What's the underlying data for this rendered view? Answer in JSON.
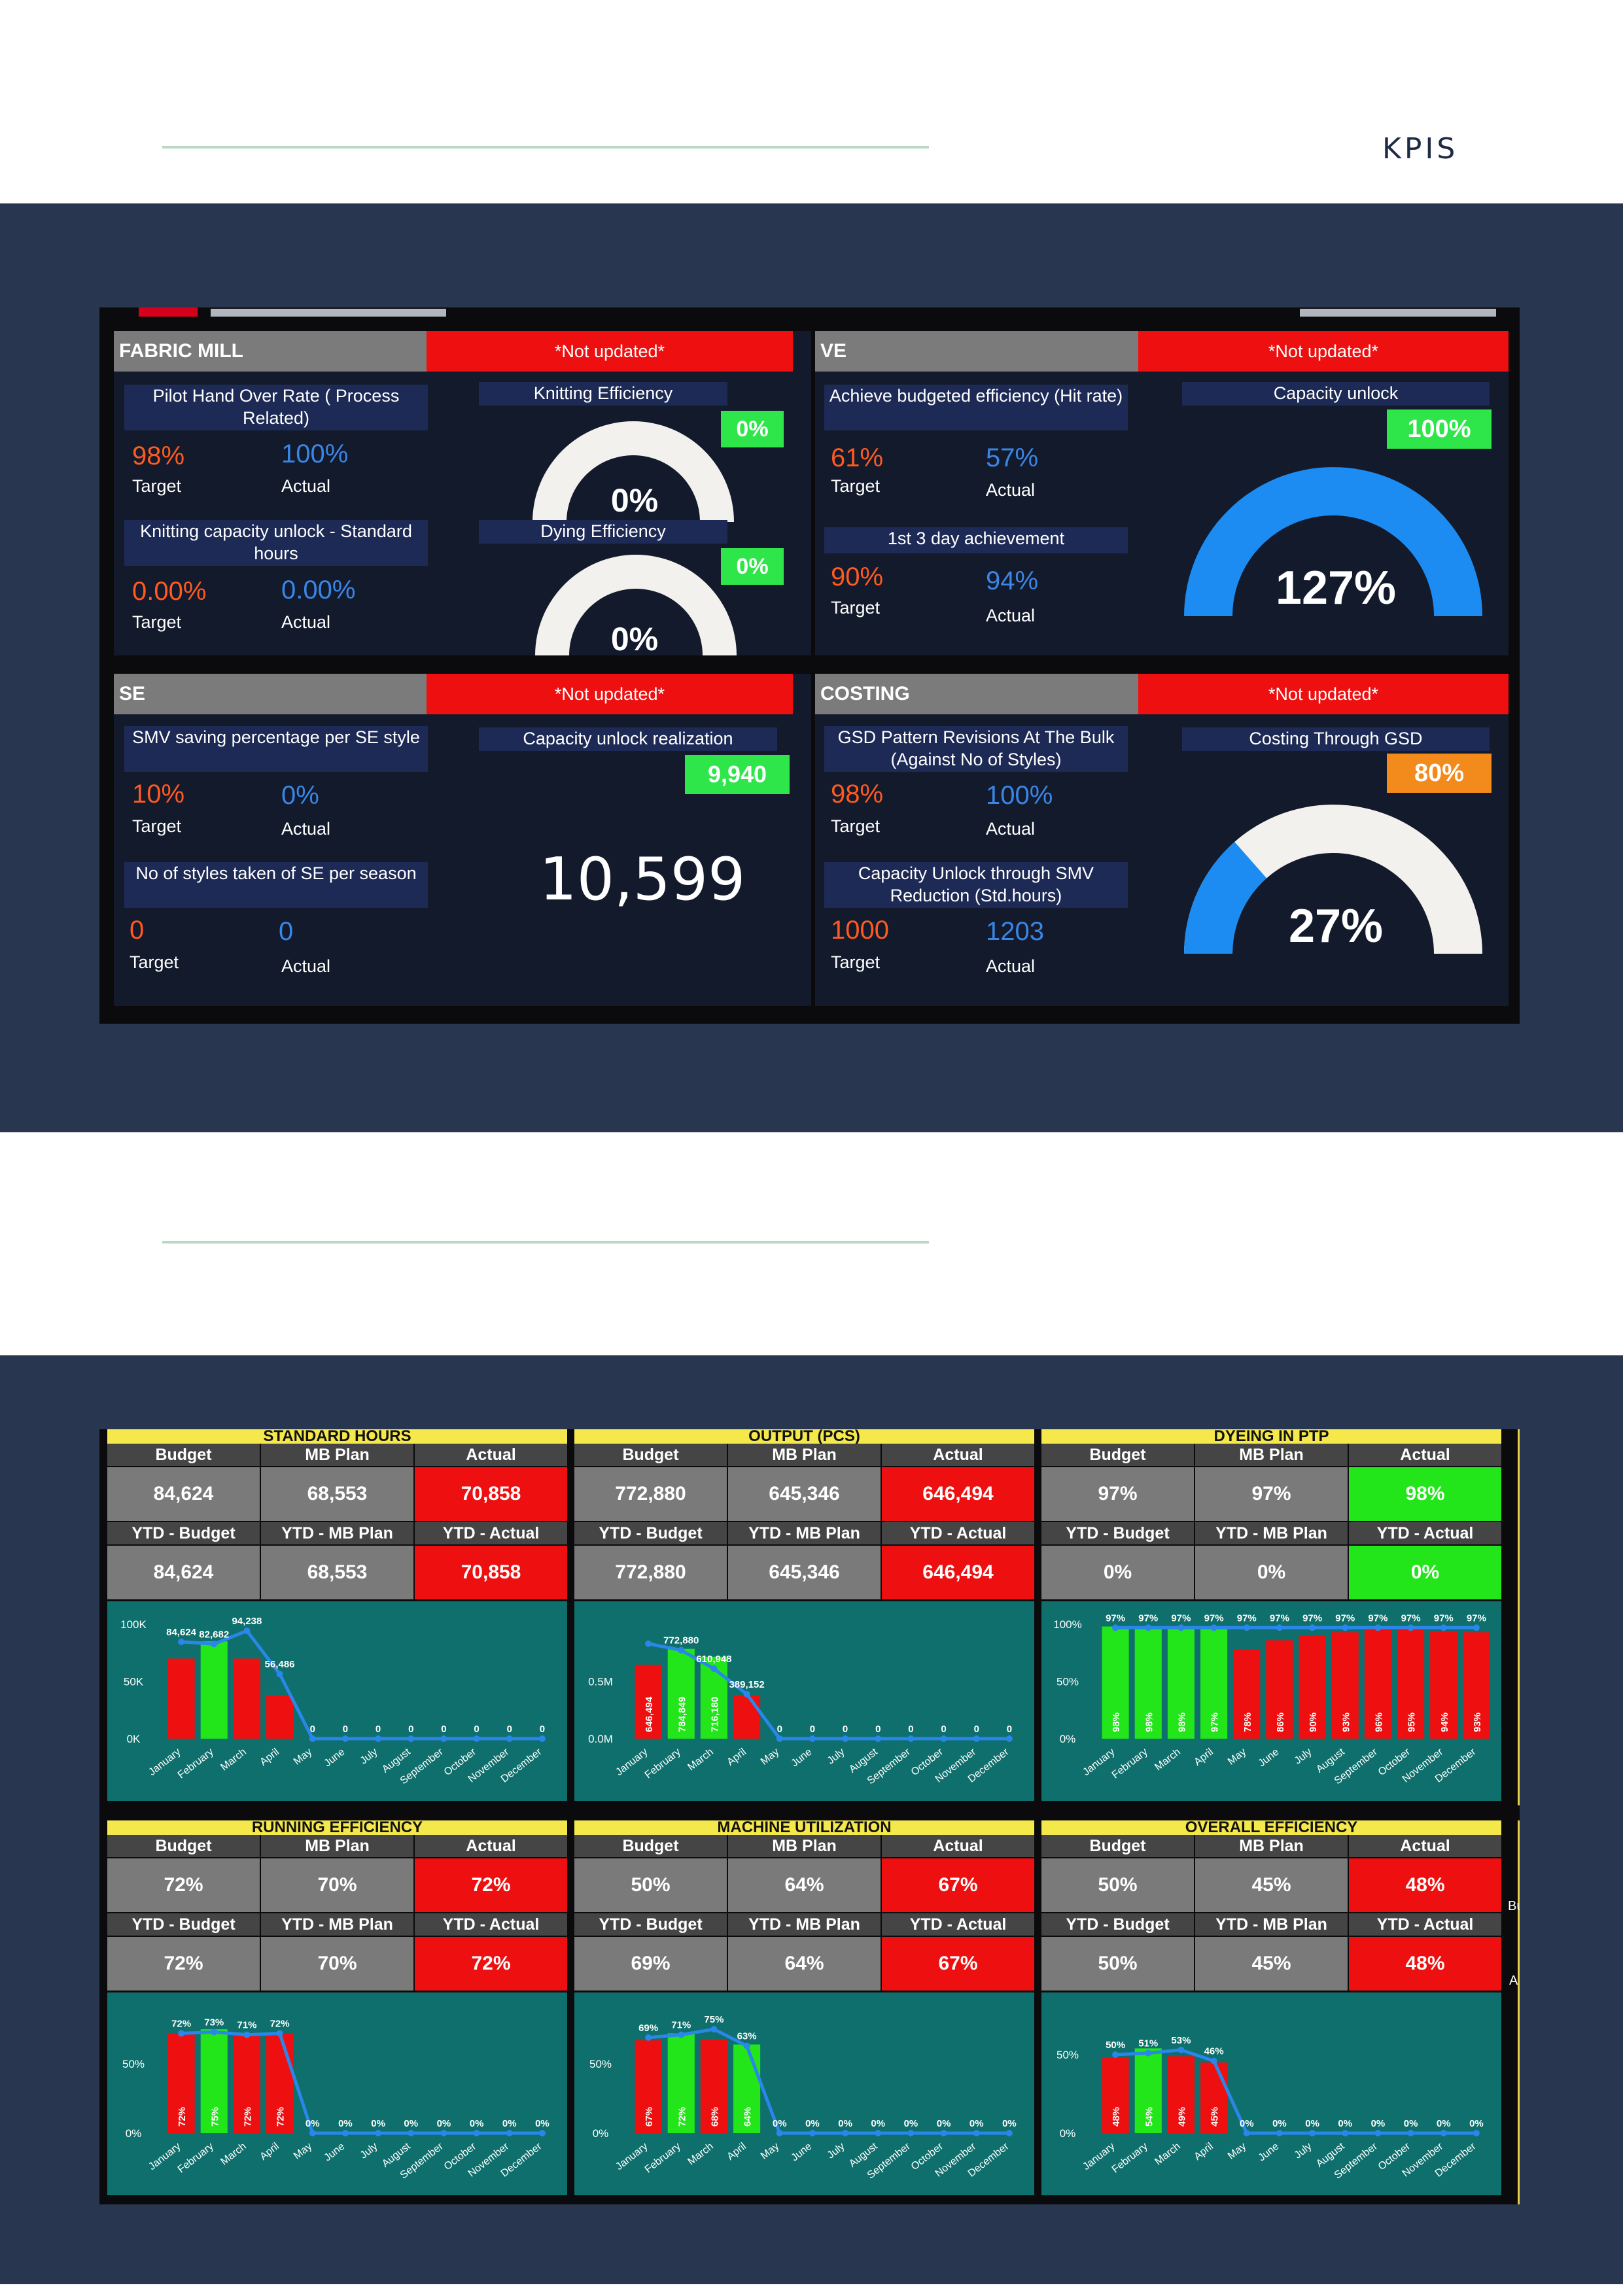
{
  "header": {
    "title": "KPIS"
  },
  "dashboard1": {
    "fabric_mill": {
      "title": "FABRIC MILL",
      "status": "*Not updated*",
      "kpi1": {
        "label": "Pilot Hand Over Rate ( Process Related)",
        "target": "98%",
        "actual": "100%"
      },
      "kpi2": {
        "label": "Knitting capacity unlock - Standard hours",
        "target": "0.00%",
        "actual": "0.00%"
      },
      "gauge1": {
        "title": "Knitting Efficiency",
        "badge": "0%",
        "value": "0%",
        "fraction": 0
      },
      "gauge2": {
        "title": "Dying Efficiency",
        "badge": "0%",
        "value": "0%",
        "fraction": 0
      }
    },
    "ve": {
      "title": "VE",
      "status": "*Not updated*",
      "kpi1": {
        "label": "Achieve budgeted efficiency (Hit rate)",
        "target": "61%",
        "actual": "57%"
      },
      "kpi2": {
        "label": "1st 3 day achievement",
        "target": "90%",
        "actual": "94%"
      },
      "gauge": {
        "title": "Capacity unlock",
        "badge": "100%",
        "value": "127%",
        "fraction": 1
      }
    },
    "se": {
      "title": "SE",
      "status": "*Not updated*",
      "kpi1": {
        "label": "SMV saving percentage per SE style",
        "target": "10%",
        "actual": "0%"
      },
      "kpi2": {
        "label": "No of styles taken of SE per season",
        "target": "0",
        "actual": "0"
      },
      "card": {
        "title": "Capacity unlock realization",
        "badge": "9,940",
        "value": "10,599"
      }
    },
    "costing": {
      "title": "COSTING",
      "status": "*Not updated*",
      "kpi1": {
        "label": "GSD Pattern Revisions At The Bulk (Against No of Styles)",
        "target": "98%",
        "actual": "100%"
      },
      "kpi2": {
        "label": "Capacity Unlock through SMV Reduction (Std.hours)",
        "target": "1000",
        "actual": "1203"
      },
      "gauge": {
        "title": "Costing Through GSD",
        "badge": "80%",
        "value": "27%",
        "fraction": 0.27
      }
    },
    "target_label": "Target",
    "actual_label": "Actual"
  },
  "dashboard2": {
    "headers": {
      "budget": "Budget",
      "mb_plan": "MB Plan",
      "actual": "Actual",
      "ytd_budget": "YTD - Budget",
      "ytd_mb_plan": "YTD - MB Plan",
      "ytd_actual": "YTD - Actual"
    },
    "months": [
      "January",
      "February",
      "March",
      "April",
      "May",
      "June",
      "July",
      "August",
      "September",
      "October",
      "November",
      "December"
    ],
    "side_labels": [
      "Bu",
      "A"
    ],
    "panels": [
      {
        "title": "STANDARD HOURS",
        "budget": "84,624",
        "mb_plan": "68,553",
        "actual": "70,858",
        "ytd_budget": "84,624",
        "ytd_mb_plan": "68,553",
        "ytd_actual": "70,858",
        "actual_color": "red"
      },
      {
        "title": "OUTPUT (PCS)",
        "budget": "772,880",
        "mb_plan": "645,346",
        "actual": "646,494",
        "ytd_budget": "772,880",
        "ytd_mb_plan": "645,346",
        "ytd_actual": "646,494",
        "actual_color": "red"
      },
      {
        "title": "DYEING IN PTP",
        "budget": "97%",
        "mb_plan": "97%",
        "actual": "98%",
        "ytd_budget": "0%",
        "ytd_mb_plan": "0%",
        "ytd_actual": "0%",
        "actual_color": "green"
      },
      {
        "title": "RUNNING EFFICIENCY",
        "budget": "72%",
        "mb_plan": "70%",
        "actual": "72%",
        "ytd_budget": "72%",
        "ytd_mb_plan": "70%",
        "ytd_actual": "72%",
        "actual_color": "red"
      },
      {
        "title": "MACHINE UTILIZATION",
        "budget": "50%",
        "mb_plan": "64%",
        "actual": "67%",
        "ytd_budget": "69%",
        "ytd_mb_plan": "64%",
        "ytd_actual": "67%",
        "actual_color": "red"
      },
      {
        "title": "OVERALL EFFICIENCY",
        "budget": "50%",
        "mb_plan": "45%",
        "actual": "48%",
        "ytd_budget": "50%",
        "ytd_mb_plan": "45%",
        "ytd_actual": "48%",
        "actual_color": "red"
      }
    ]
  },
  "chart_data": [
    {
      "type": "bar",
      "title": "STANDARD HOURS",
      "ytick_labels": [
        "0K",
        "50K",
        "100K"
      ],
      "ylim": [
        0,
        100000
      ],
      "categories": [
        "January",
        "February",
        "March",
        "April",
        "May",
        "June",
        "July",
        "August",
        "September",
        "October",
        "November",
        "December"
      ],
      "series": [
        {
          "kind": "bar",
          "values": [
            70000,
            85000,
            70000,
            38000,
            null,
            null,
            null,
            null,
            null,
            null,
            null,
            null
          ],
          "colors": [
            "red",
            "green",
            "red",
            "red"
          ]
        },
        {
          "kind": "line",
          "values": [
            84624,
            82682,
            94238,
            56486,
            0,
            0,
            0,
            0,
            0,
            0,
            0,
            0
          ]
        }
      ],
      "data_labels": [
        {
          "month": "January",
          "text": "84,624",
          "value": 84624
        },
        {
          "month": "February",
          "text": "82,682",
          "value": 82682
        },
        {
          "month": "March",
          "text": "94,238",
          "value": 94238
        },
        {
          "month": "April",
          "text": "56,486",
          "value": 56486
        },
        {
          "month": "May",
          "text": "0",
          "value": 0
        },
        {
          "month": "June",
          "text": "0",
          "value": 0
        },
        {
          "month": "July",
          "text": "0",
          "value": 0
        },
        {
          "month": "August",
          "text": "0",
          "value": 0
        },
        {
          "month": "September",
          "text": "0",
          "value": 0
        },
        {
          "month": "October",
          "text": "0",
          "value": 0
        },
        {
          "month": "November",
          "text": "0",
          "value": 0
        },
        {
          "month": "December",
          "text": "0",
          "value": 0
        }
      ]
    },
    {
      "type": "bar",
      "title": "OUTPUT (PCS)",
      "ytick_labels": [
        "0.0M",
        "0.5M"
      ],
      "ylim": [
        0,
        1000000
      ],
      "categories": [
        "January",
        "February",
        "March",
        "April",
        "May",
        "June",
        "July",
        "August",
        "September",
        "October",
        "November",
        "December"
      ],
      "series": [
        {
          "kind": "bar",
          "values": [
            646494,
            784849,
            716180,
            380000,
            null,
            null,
            null,
            null,
            null,
            null,
            null,
            null
          ],
          "colors": [
            "red",
            "green",
            "green",
            "red"
          ],
          "inner_labels": [
            "646,494",
            "784,849",
            "716,180",
            ""
          ]
        },
        {
          "kind": "line",
          "values": [
            830000,
            772880,
            610948,
            389152,
            0,
            0,
            0,
            0,
            0,
            0,
            0,
            0
          ]
        }
      ],
      "data_labels": [
        {
          "month": "February",
          "text": "772,880",
          "value": 772880
        },
        {
          "month": "March",
          "text": "610,948",
          "value": 610948
        },
        {
          "month": "April",
          "text": "389,152",
          "value": 389152
        },
        {
          "month": "May",
          "text": "0",
          "value": 0
        },
        {
          "month": "June",
          "text": "0",
          "value": 0
        },
        {
          "month": "July",
          "text": "0",
          "value": 0
        },
        {
          "month": "August",
          "text": "0",
          "value": 0
        },
        {
          "month": "September",
          "text": "0",
          "value": 0
        },
        {
          "month": "October",
          "text": "0",
          "value": 0
        },
        {
          "month": "November",
          "text": "0",
          "value": 0
        },
        {
          "month": "December",
          "text": "0",
          "value": 0
        }
      ]
    },
    {
      "type": "bar",
      "title": "DYEING IN PTP",
      "ytick_labels": [
        "0%",
        "50%",
        "100%"
      ],
      "ylim": [
        0,
        100
      ],
      "categories": [
        "January",
        "February",
        "March",
        "April",
        "May",
        "June",
        "July",
        "August",
        "September",
        "October",
        "November",
        "December"
      ],
      "series": [
        {
          "kind": "bar",
          "values": [
            98,
            98,
            98,
            97,
            78,
            86,
            90,
            93,
            96,
            95,
            94,
            93
          ],
          "colors": [
            "green",
            "green",
            "green",
            "green",
            "red",
            "red",
            "red",
            "red",
            "red",
            "red",
            "red",
            "red"
          ],
          "inner_labels": [
            "98%",
            "98%",
            "98%",
            "97%",
            "78%",
            "86%",
            "90%",
            "93%",
            "96%",
            "95%",
            "94%",
            "93%"
          ]
        },
        {
          "kind": "line",
          "values": [
            97,
            97,
            97,
            97,
            97,
            97,
            97,
            97,
            97,
            97,
            97,
            97
          ]
        }
      ],
      "data_labels": [
        {
          "month": "January",
          "text": "97%",
          "value": 97
        },
        {
          "month": "February",
          "text": "97%",
          "value": 97
        },
        {
          "month": "March",
          "text": "97%",
          "value": 97
        },
        {
          "month": "April",
          "text": "97%",
          "value": 97
        },
        {
          "month": "May",
          "text": "97%",
          "value": 97
        },
        {
          "month": "June",
          "text": "97%",
          "value": 97
        },
        {
          "month": "July",
          "text": "97%",
          "value": 97
        },
        {
          "month": "August",
          "text": "97%",
          "value": 97
        },
        {
          "month": "September",
          "text": "97%",
          "value": 97
        },
        {
          "month": "October",
          "text": "97%",
          "value": 97
        },
        {
          "month": "November",
          "text": "97%",
          "value": 97
        },
        {
          "month": "December",
          "text": "97%",
          "value": 97
        }
      ]
    },
    {
      "type": "bar",
      "title": "RUNNING EFFICIENCY",
      "ytick_labels": [
        "0%",
        "50%"
      ],
      "ylim": [
        0,
        85
      ],
      "categories": [
        "January",
        "February",
        "March",
        "April",
        "May",
        "June",
        "July",
        "August",
        "September",
        "October",
        "November",
        "December"
      ],
      "series": [
        {
          "kind": "bar",
          "values": [
            72,
            75,
            72,
            72,
            null,
            null,
            null,
            null,
            null,
            null,
            null,
            null
          ],
          "colors": [
            "red",
            "green",
            "red",
            "red"
          ],
          "inner_labels": [
            "72%",
            "75%",
            "72%",
            "72%"
          ]
        },
        {
          "kind": "line",
          "values": [
            72,
            73,
            71,
            72,
            0,
            0,
            0,
            0,
            0,
            0,
            0,
            0
          ]
        }
      ],
      "data_labels": [
        {
          "month": "January",
          "text": "72%",
          "value": 72
        },
        {
          "month": "February",
          "text": "73%",
          "value": 73
        },
        {
          "month": "March",
          "text": "71%",
          "value": 71
        },
        {
          "month": "April",
          "text": "72%",
          "value": 72
        },
        {
          "month": "May",
          "text": "0%",
          "value": 0
        },
        {
          "month": "June",
          "text": "0%",
          "value": 0
        },
        {
          "month": "July",
          "text": "0%",
          "value": 0
        },
        {
          "month": "August",
          "text": "0%",
          "value": 0
        },
        {
          "month": "September",
          "text": "0%",
          "value": 0
        },
        {
          "month": "October",
          "text": "0%",
          "value": 0
        },
        {
          "month": "November",
          "text": "0%",
          "value": 0
        },
        {
          "month": "December",
          "text": "0%",
          "value": 0
        }
      ]
    },
    {
      "type": "bar",
      "title": "MACHINE UTILIZATION",
      "ytick_labels": [
        "0%",
        "50%"
      ],
      "ylim": [
        0,
        85
      ],
      "categories": [
        "January",
        "February",
        "March",
        "April",
        "May",
        "June",
        "July",
        "August",
        "September",
        "October",
        "November",
        "December"
      ],
      "series": [
        {
          "kind": "bar",
          "values": [
            67,
            72,
            68,
            64,
            null,
            null,
            null,
            null,
            null,
            null,
            null,
            null
          ],
          "colors": [
            "red",
            "green",
            "red",
            "green"
          ],
          "inner_labels": [
            "67%",
            "72%",
            "68%",
            "64%"
          ]
        },
        {
          "kind": "line",
          "values": [
            69,
            71,
            75,
            63,
            0,
            0,
            0,
            0,
            0,
            0,
            0,
            0
          ]
        }
      ],
      "data_labels": [
        {
          "month": "January",
          "text": "69%",
          "value": 69
        },
        {
          "month": "February",
          "text": "71%",
          "value": 71
        },
        {
          "month": "March",
          "text": "75%",
          "value": 75
        },
        {
          "month": "April",
          "text": "63%",
          "value": 63
        },
        {
          "month": "May",
          "text": "0%",
          "value": 0
        },
        {
          "month": "June",
          "text": "0%",
          "value": 0
        },
        {
          "month": "July",
          "text": "0%",
          "value": 0
        },
        {
          "month": "August",
          "text": "0%",
          "value": 0
        },
        {
          "month": "September",
          "text": "0%",
          "value": 0
        },
        {
          "month": "October",
          "text": "0%",
          "value": 0
        },
        {
          "month": "November",
          "text": "0%",
          "value": 0
        },
        {
          "month": "December",
          "text": "0%",
          "value": 0
        }
      ]
    },
    {
      "type": "bar",
      "title": "OVERALL EFFICIENCY",
      "ytick_labels": [
        "0%",
        "50%"
      ],
      "ylim": [
        0,
        75
      ],
      "categories": [
        "January",
        "February",
        "March",
        "April",
        "May",
        "June",
        "July",
        "August",
        "September",
        "October",
        "November",
        "December"
      ],
      "series": [
        {
          "kind": "bar",
          "values": [
            48,
            54,
            49,
            45,
            null,
            null,
            null,
            null,
            null,
            null,
            null,
            null
          ],
          "colors": [
            "red",
            "green",
            "red",
            "red"
          ],
          "inner_labels": [
            "48%",
            "54%",
            "49%",
            "45%"
          ]
        },
        {
          "kind": "line",
          "values": [
            50,
            51,
            53,
            46,
            0,
            0,
            0,
            0,
            0,
            0,
            0,
            0
          ]
        }
      ],
      "data_labels": [
        {
          "month": "January",
          "text": "50%",
          "value": 50
        },
        {
          "month": "February",
          "text": "51%",
          "value": 51
        },
        {
          "month": "March",
          "text": "53%",
          "value": 53
        },
        {
          "month": "April",
          "text": "46%",
          "value": 46
        },
        {
          "month": "May",
          "text": "0%",
          "value": 0
        },
        {
          "month": "June",
          "text": "0%",
          "value": 0
        },
        {
          "month": "July",
          "text": "0%",
          "value": 0
        },
        {
          "month": "August",
          "text": "0%",
          "value": 0
        },
        {
          "month": "September",
          "text": "0%",
          "value": 0
        },
        {
          "month": "October",
          "text": "0%",
          "value": 0
        },
        {
          "month": "November",
          "text": "0%",
          "value": 0
        },
        {
          "month": "December",
          "text": "0%",
          "value": 0
        }
      ]
    }
  ],
  "colors": {
    "navy": "#283650",
    "red": "#ee1010",
    "green": "#22e51a",
    "teal": "#0e6f6c",
    "line": "#2a86e8",
    "orange_value": "#ff5a1f",
    "blue_value": "#3a86e6"
  }
}
